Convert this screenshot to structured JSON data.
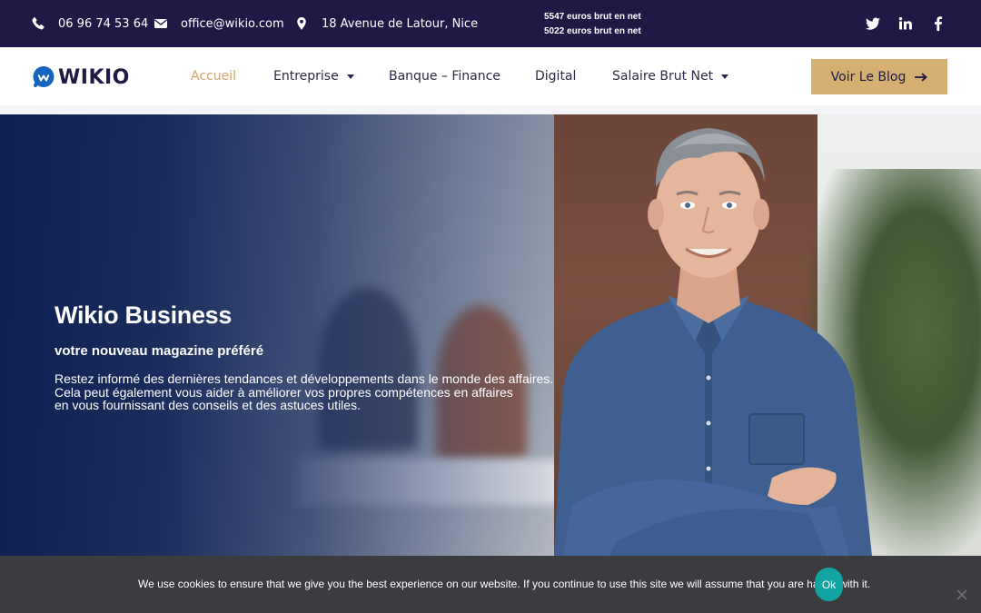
{
  "topbar": {
    "phone": "06 96 74 53 64",
    "email": "office@wikio.com",
    "address": "18 Avenue de Latour, Nice",
    "salary_line1": "5547 euros brut en net",
    "salary_line2": "5022 euros brut en net",
    "phone_icon": "phone-icon",
    "email_icon": "envelope-icon",
    "address_icon": "map-marker-icon",
    "social_icons": [
      "twitter-icon",
      "linkedin-icon",
      "facebook-icon"
    ]
  },
  "nav": {
    "logo_text": "WIKIO",
    "items": [
      {
        "label": "Accueil",
        "active": true,
        "dropdown": false
      },
      {
        "label": "Entreprise",
        "active": false,
        "dropdown": true
      },
      {
        "label": "Banque – Finance",
        "active": false,
        "dropdown": false
      },
      {
        "label": "Digital",
        "active": false,
        "dropdown": false
      },
      {
        "label": "Salaire Brut Net",
        "active": false,
        "dropdown": true
      }
    ],
    "cta_label": "Voir Le Blog",
    "cta_icon": "arrow-right-icon"
  },
  "hero": {
    "title": "Wikio Business",
    "subtitle": "votre nouveau magazine préféré",
    "description_lines": [
      "Restez informé des dernières tendances et développements dans le monde des affaires.",
      "Cela peut également vous aider à améliorer vos propres compétences en affaires",
      "en vous fournissant des conseils et des astuces utiles."
    ]
  },
  "cookie": {
    "text": "We use cookies to ensure that we give you the best experience on our website. If you continue to use this site we will assume that you are happy with it.",
    "ok_label": "Ok",
    "close_icon": "close-icon"
  },
  "colors": {
    "topbar_bg": "#1e1a45",
    "accent_gold": "#d4b073",
    "active_link": "#d4a56a",
    "cookie_bg": "#3b3c40",
    "ok_button": "#14a3a3"
  }
}
